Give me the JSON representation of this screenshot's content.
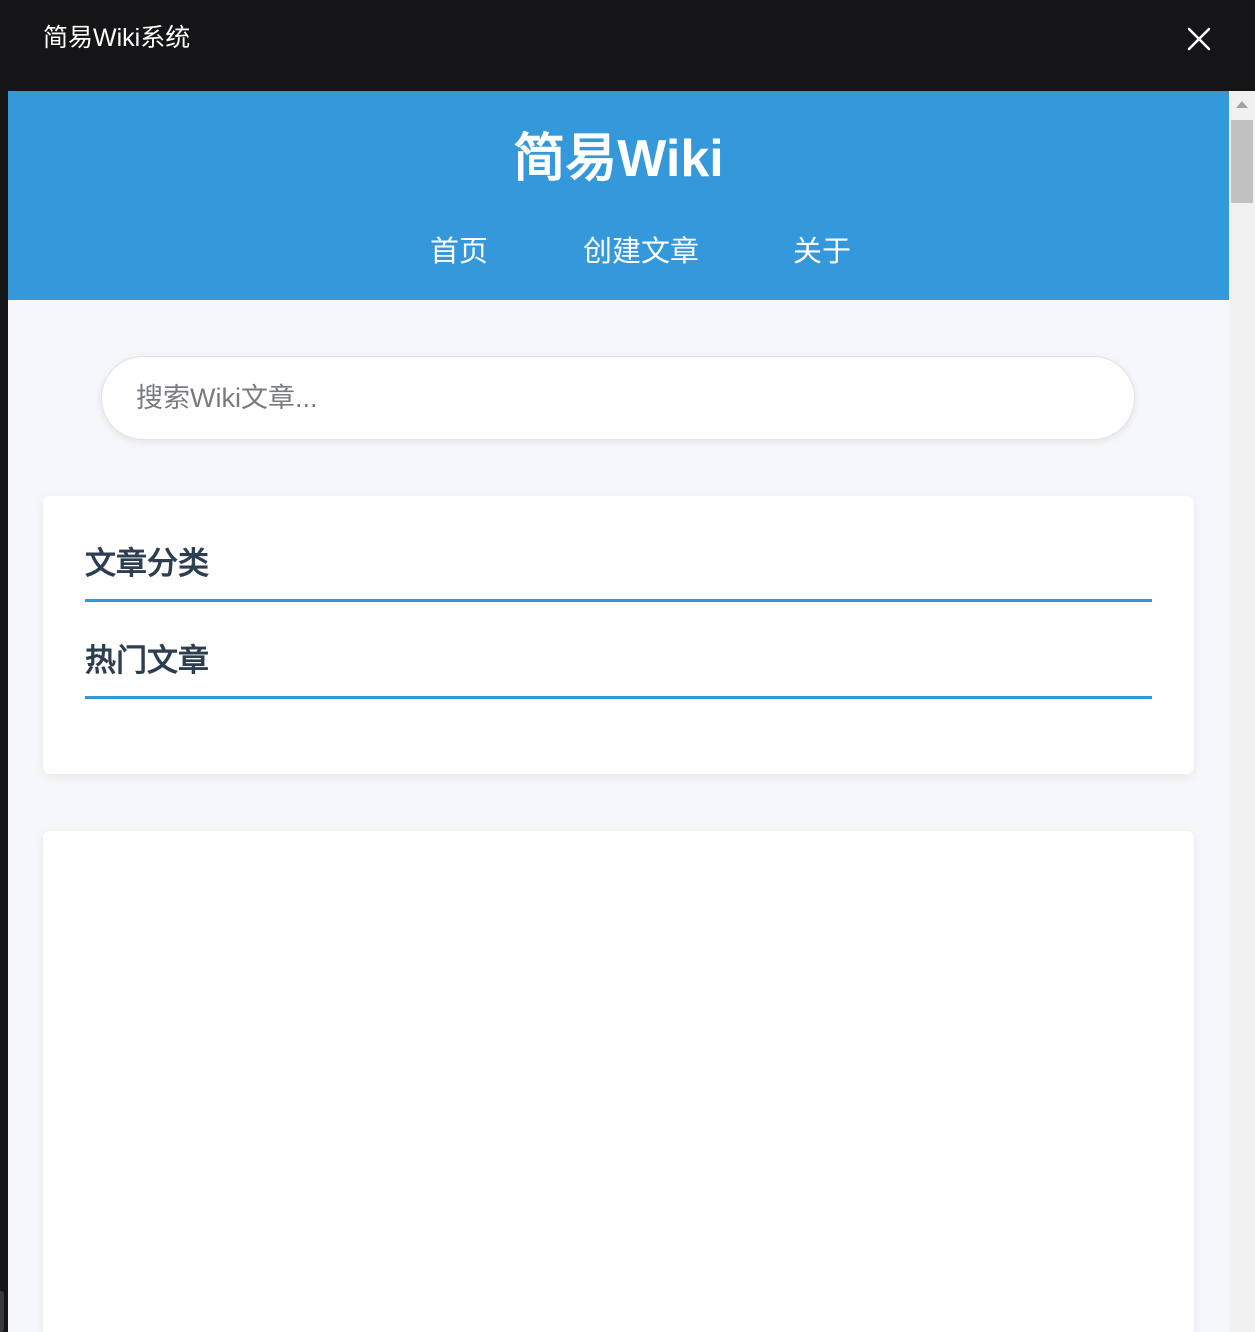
{
  "window": {
    "title": "简易Wiki系统",
    "close_icon": "close-icon"
  },
  "header": {
    "site_title": "简易Wiki",
    "nav": [
      {
        "label": "首页"
      },
      {
        "label": "创建文章"
      },
      {
        "label": "关于"
      }
    ]
  },
  "search": {
    "placeholder": "搜索Wiki文章...",
    "value": ""
  },
  "sidebar": {
    "categories_title": "文章分类",
    "popular_title": "热门文章"
  },
  "colors": {
    "titlebar": "#151517",
    "header_bg": "#3498db",
    "page_bg": "#f5f7fa",
    "heading_text": "#2c3e50",
    "accent_border": "#3498db"
  }
}
